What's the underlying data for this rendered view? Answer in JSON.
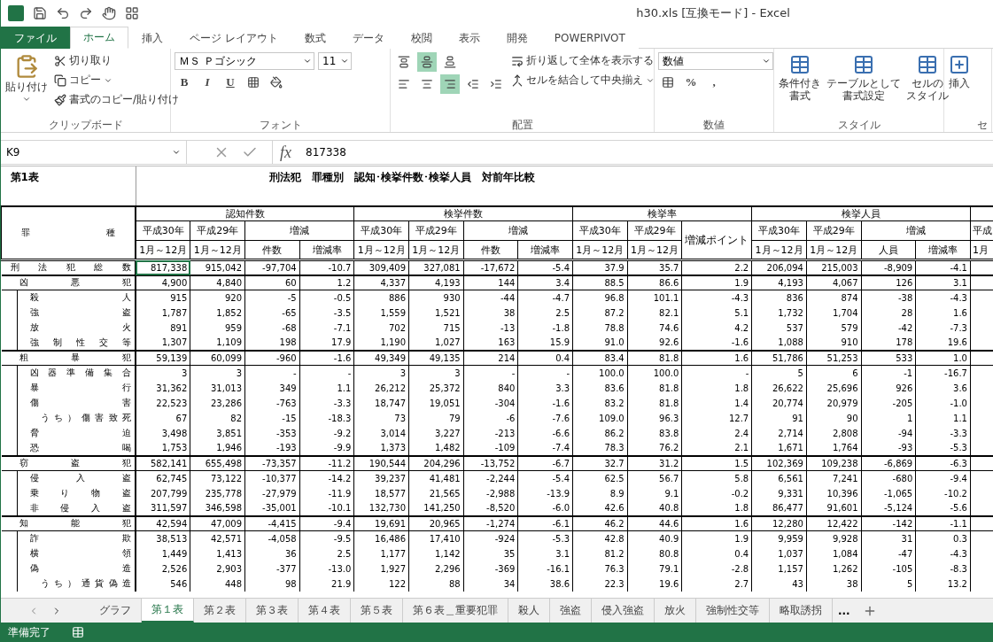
{
  "window": {
    "title": "h30.xls  [互換モード] - Excel"
  },
  "ribbon_tabs": [
    {
      "label": "ファイル",
      "kind": "file",
      "selected": false
    },
    {
      "label": "ホーム",
      "kind": "tab",
      "selected": true
    },
    {
      "label": "挿入",
      "kind": "tab",
      "selected": false
    },
    {
      "label": "ページ レイアウト",
      "kind": "tab",
      "selected": false
    },
    {
      "label": "数式",
      "kind": "tab",
      "selected": false
    },
    {
      "label": "データ",
      "kind": "tab",
      "selected": false
    },
    {
      "label": "校閲",
      "kind": "tab",
      "selected": false
    },
    {
      "label": "表示",
      "kind": "tab",
      "selected": false
    },
    {
      "label": "開発",
      "kind": "tab",
      "selected": false
    },
    {
      "label": "POWERPIVOT",
      "kind": "tab",
      "selected": false
    }
  ],
  "ribbon": {
    "clipboard": {
      "label": "クリップボード",
      "paste": "貼り付け",
      "cut": "切り取り",
      "copy": "コピー",
      "format_painter": "書式のコピー/貼り付け"
    },
    "font": {
      "label": "フォント",
      "name": "ＭＳ Ｐゴシック",
      "size": "11",
      "bold": "B",
      "italic": "I",
      "underline": "U"
    },
    "alignment": {
      "label": "配置",
      "wrap": "折り返して全体を表示する",
      "merge": "セルを結合して中央揃え",
      "vertical": [
        {
          "selected": false
        },
        {
          "selected": true
        },
        {
          "selected": false
        }
      ],
      "horizontal": [
        {
          "selected": false
        },
        {
          "selected": false
        },
        {
          "selected": true
        }
      ]
    },
    "number": {
      "label": "数値",
      "format": "数値",
      "percent": "%",
      "comma": ","
    },
    "styles": {
      "label": "スタイル",
      "buttons": [
        {
          "lines": [
            "条件付き",
            "書式"
          ]
        },
        {
          "lines": [
            "テーブルとして",
            "書式設定"
          ]
        },
        {
          "lines": [
            "セルの",
            "スタイル"
          ]
        }
      ]
    },
    "cells": {
      "insert": "挿入",
      "label": "セ"
    }
  },
  "formula_bar": {
    "cell": "K9",
    "fx": "fx",
    "value": "817338"
  },
  "sheet": {
    "label": "第1表",
    "title": "刑法犯　罪種別　認知･検挙件数･検挙人員　対前年比較",
    "row_header": "罪種",
    "groups": [
      {
        "title": "認知件数",
        "columns": [
          {
            "kind": "period",
            "top": "平成30年",
            "bottom": "1月～12月"
          },
          {
            "kind": "period",
            "top": "平成29年",
            "bottom": "1月～12月"
          },
          {
            "kind": "change",
            "top": "増減",
            "subs": [
              "件数",
              "増減率"
            ]
          }
        ]
      },
      {
        "title": "検挙件数",
        "columns": [
          {
            "kind": "period",
            "top": "平成30年",
            "bottom": "1月～12月"
          },
          {
            "kind": "period",
            "top": "平成29年",
            "bottom": "1月～12月"
          },
          {
            "kind": "change",
            "top": "増減",
            "subs": [
              "件数",
              "増減率"
            ]
          }
        ]
      },
      {
        "title": "検挙率",
        "columns": [
          {
            "kind": "period",
            "top": "平成30年",
            "bottom": "1月～12月"
          },
          {
            "kind": "period",
            "top": "平成29年",
            "bottom": "1月～12月"
          },
          {
            "kind": "single",
            "top": "増減ポイント"
          }
        ]
      },
      {
        "title": "検挙人員",
        "columns": [
          {
            "kind": "period",
            "top": "平成30年",
            "bottom": "1月～12月"
          },
          {
            "kind": "period",
            "top": "平成29年",
            "bottom": "1月～12月"
          },
          {
            "kind": "change",
            "top": "増減",
            "subs": [
              "人員",
              "増減率"
            ]
          }
        ]
      }
    ],
    "cut_column": {
      "top": "平成",
      "bottom": "1月"
    },
    "rows": [
      {
        "name": "刑法犯総数",
        "selected": true,
        "values": [
          "817,338",
          "915,042",
          "-97,704",
          "-10.7",
          "309,409",
          "327,081",
          "-17,672",
          "-5.4",
          "37.9",
          "35.7",
          "2.2",
          "206,094",
          "215,003",
          "-8,909",
          "-4.1"
        ],
        "children": [
          {
            "name": "凶悪犯",
            "selected": false,
            "values": [
              "4,900",
              "4,840",
              "60",
              "1.2",
              "4,337",
              "4,193",
              "144",
              "3.4",
              "88.5",
              "86.6",
              "1.9",
              "4,193",
              "4,067",
              "126",
              "3.1"
            ],
            "children": [
              {
                "name": "殺人",
                "selected": false,
                "values": [
                  "915",
                  "920",
                  "-5",
                  "-0.5",
                  "886",
                  "930",
                  "-44",
                  "-4.7",
                  "96.8",
                  "101.1",
                  "-4.3",
                  "836",
                  "874",
                  "-38",
                  "-4.3"
                ]
              },
              {
                "name": "強盗",
                "selected": false,
                "values": [
                  "1,787",
                  "1,852",
                  "-65",
                  "-3.5",
                  "1,559",
                  "1,521",
                  "38",
                  "2.5",
                  "87.2",
                  "82.1",
                  "5.1",
                  "1,732",
                  "1,704",
                  "28",
                  "1.6"
                ]
              },
              {
                "name": "放火",
                "selected": false,
                "values": [
                  "891",
                  "959",
                  "-68",
                  "-7.1",
                  "702",
                  "715",
                  "-13",
                  "-1.8",
                  "78.8",
                  "74.6",
                  "4.2",
                  "537",
                  "579",
                  "-42",
                  "-7.3"
                ]
              },
              {
                "name": "強制性交等",
                "selected": false,
                "values": [
                  "1,307",
                  "1,109",
                  "198",
                  "17.9",
                  "1,190",
                  "1,027",
                  "163",
                  "15.9",
                  "91.0",
                  "92.6",
                  "-1.6",
                  "1,088",
                  "910",
                  "178",
                  "19.6"
                ]
              }
            ]
          },
          {
            "name": "粗暴犯",
            "selected": false,
            "values": [
              "59,139",
              "60,099",
              "-960",
              "-1.6",
              "49,349",
              "49,135",
              "214",
              "0.4",
              "83.4",
              "81.8",
              "1.6",
              "51,786",
              "51,253",
              "533",
              "1.0"
            ],
            "children": [
              {
                "name": "凶器準備集合",
                "selected": false,
                "values": [
                  "3",
                  "3",
                  "-",
                  "-",
                  "3",
                  "3",
                  "-",
                  "-",
                  "100.0",
                  "100.0",
                  "-",
                  "5",
                  "6",
                  "-1",
                  "-16.7"
                ]
              },
              {
                "name": "暴行",
                "selected": false,
                "values": [
                  "31,362",
                  "31,013",
                  "349",
                  "1.1",
                  "26,212",
                  "25,372",
                  "840",
                  "3.3",
                  "83.6",
                  "81.8",
                  "1.8",
                  "26,622",
                  "25,696",
                  "926",
                  "3.6"
                ]
              },
              {
                "name": "傷害",
                "selected": false,
                "values": [
                  "22,523",
                  "23,286",
                  "-763",
                  "-3.3",
                  "18,747",
                  "19,051",
                  "-304",
                  "-1.6",
                  "83.2",
                  "81.8",
                  "1.4",
                  "20,774",
                  "20,979",
                  "-205",
                  "-1.0"
                ],
                "children": [
                  {
                    "name": "うち）傷害致死",
                    "selected": false,
                    "values": [
                      "67",
                      "82",
                      "-15",
                      "-18.3",
                      "73",
                      "79",
                      "-6",
                      "-7.6",
                      "109.0",
                      "96.3",
                      "12.7",
                      "91",
                      "90",
                      "1",
                      "1.1"
                    ]
                  }
                ]
              },
              {
                "name": "脅迫",
                "selected": false,
                "values": [
                  "3,498",
                  "3,851",
                  "-353",
                  "-9.2",
                  "3,014",
                  "3,227",
                  "-213",
                  "-6.6",
                  "86.2",
                  "83.8",
                  "2.4",
                  "2,714",
                  "2,808",
                  "-94",
                  "-3.3"
                ]
              },
              {
                "name": "恐喝",
                "selected": false,
                "values": [
                  "1,753",
                  "1,946",
                  "-193",
                  "-9.9",
                  "1,373",
                  "1,482",
                  "-109",
                  "-7.4",
                  "78.3",
                  "76.2",
                  "2.1",
                  "1,671",
                  "1,764",
                  "-93",
                  "-5.3"
                ]
              }
            ]
          },
          {
            "name": "窃盗犯",
            "selected": false,
            "values": [
              "582,141",
              "655,498",
              "-73,357",
              "-11.2",
              "190,544",
              "204,296",
              "-13,752",
              "-6.7",
              "32.7",
              "31.2",
              "1.5",
              "102,369",
              "109,238",
              "-6,869",
              "-6.3"
            ],
            "children": [
              {
                "name": "侵入盗",
                "selected": false,
                "values": [
                  "62,745",
                  "73,122",
                  "-10,377",
                  "-14.2",
                  "39,237",
                  "41,481",
                  "-2,244",
                  "-5.4",
                  "62.5",
                  "56.7",
                  "5.8",
                  "6,561",
                  "7,241",
                  "-680",
                  "-9.4"
                ]
              },
              {
                "name": "乗り物盗",
                "selected": false,
                "values": [
                  "207,799",
                  "235,778",
                  "-27,979",
                  "-11.9",
                  "18,577",
                  "21,565",
                  "-2,988",
                  "-13.9",
                  "8.9",
                  "9.1",
                  "-0.2",
                  "9,331",
                  "10,396",
                  "-1,065",
                  "-10.2"
                ]
              },
              {
                "name": "非侵入盗",
                "selected": false,
                "values": [
                  "311,597",
                  "346,598",
                  "-35,001",
                  "-10.1",
                  "132,730",
                  "141,250",
                  "-8,520",
                  "-6.0",
                  "42.6",
                  "40.8",
                  "1.8",
                  "86,477",
                  "91,601",
                  "-5,124",
                  "-5.6"
                ]
              }
            ]
          },
          {
            "name": "知能犯",
            "selected": false,
            "values": [
              "42,594",
              "47,009",
              "-4,415",
              "-9.4",
              "19,691",
              "20,965",
              "-1,274",
              "-6.1",
              "46.2",
              "44.6",
              "1.6",
              "12,280",
              "12,422",
              "-142",
              "-1.1"
            ],
            "children": [
              {
                "name": "詐欺",
                "selected": false,
                "values": [
                  "38,513",
                  "42,571",
                  "-4,058",
                  "-9.5",
                  "16,486",
                  "17,410",
                  "-924",
                  "-5.3",
                  "42.8",
                  "40.9",
                  "1.9",
                  "9,959",
                  "9,928",
                  "31",
                  "0.3"
                ]
              },
              {
                "name": "横領",
                "selected": false,
                "values": [
                  "1,449",
                  "1,413",
                  "36",
                  "2.5",
                  "1,177",
                  "1,142",
                  "35",
                  "3.1",
                  "81.2",
                  "80.8",
                  "0.4",
                  "1,037",
                  "1,084",
                  "-47",
                  "-4.3"
                ]
              },
              {
                "name": "偽造",
                "selected": false,
                "values": [
                  "2,526",
                  "2,903",
                  "-377",
                  "-13.0",
                  "1,927",
                  "2,296",
                  "-369",
                  "-16.1",
                  "76.3",
                  "79.1",
                  "-2.8",
                  "1,157",
                  "1,262",
                  "-105",
                  "-8.3"
                ],
                "children": [
                  {
                    "name": "うち）通貨偽造",
                    "selected": false,
                    "values": [
                      "546",
                      "448",
                      "98",
                      "21.9",
                      "122",
                      "88",
                      "34",
                      "38.6",
                      "22.3",
                      "19.6",
                      "2.7",
                      "43",
                      "38",
                      "5",
                      "13.2"
                    ]
                  }
                ]
              }
            ]
          }
        ]
      }
    ]
  },
  "sheet_tabs": [
    {
      "label": "グラフ",
      "selected": false
    },
    {
      "label": "第１表",
      "selected": true
    },
    {
      "label": "第２表",
      "selected": false
    },
    {
      "label": "第３表",
      "selected": false
    },
    {
      "label": "第４表",
      "selected": false
    },
    {
      "label": "第５表",
      "selected": false
    },
    {
      "label": "第６表＿重要犯罪",
      "selected": false
    },
    {
      "label": "殺人",
      "selected": false
    },
    {
      "label": "強盗",
      "selected": false
    },
    {
      "label": "侵入強盗",
      "selected": false
    },
    {
      "label": "放火",
      "selected": false
    },
    {
      "label": "強制性交等",
      "selected": false
    },
    {
      "label": "略取誘拐",
      "selected": false
    }
  ],
  "sheet_tabs_more": "...",
  "status_bar": {
    "text": "準備完了"
  }
}
